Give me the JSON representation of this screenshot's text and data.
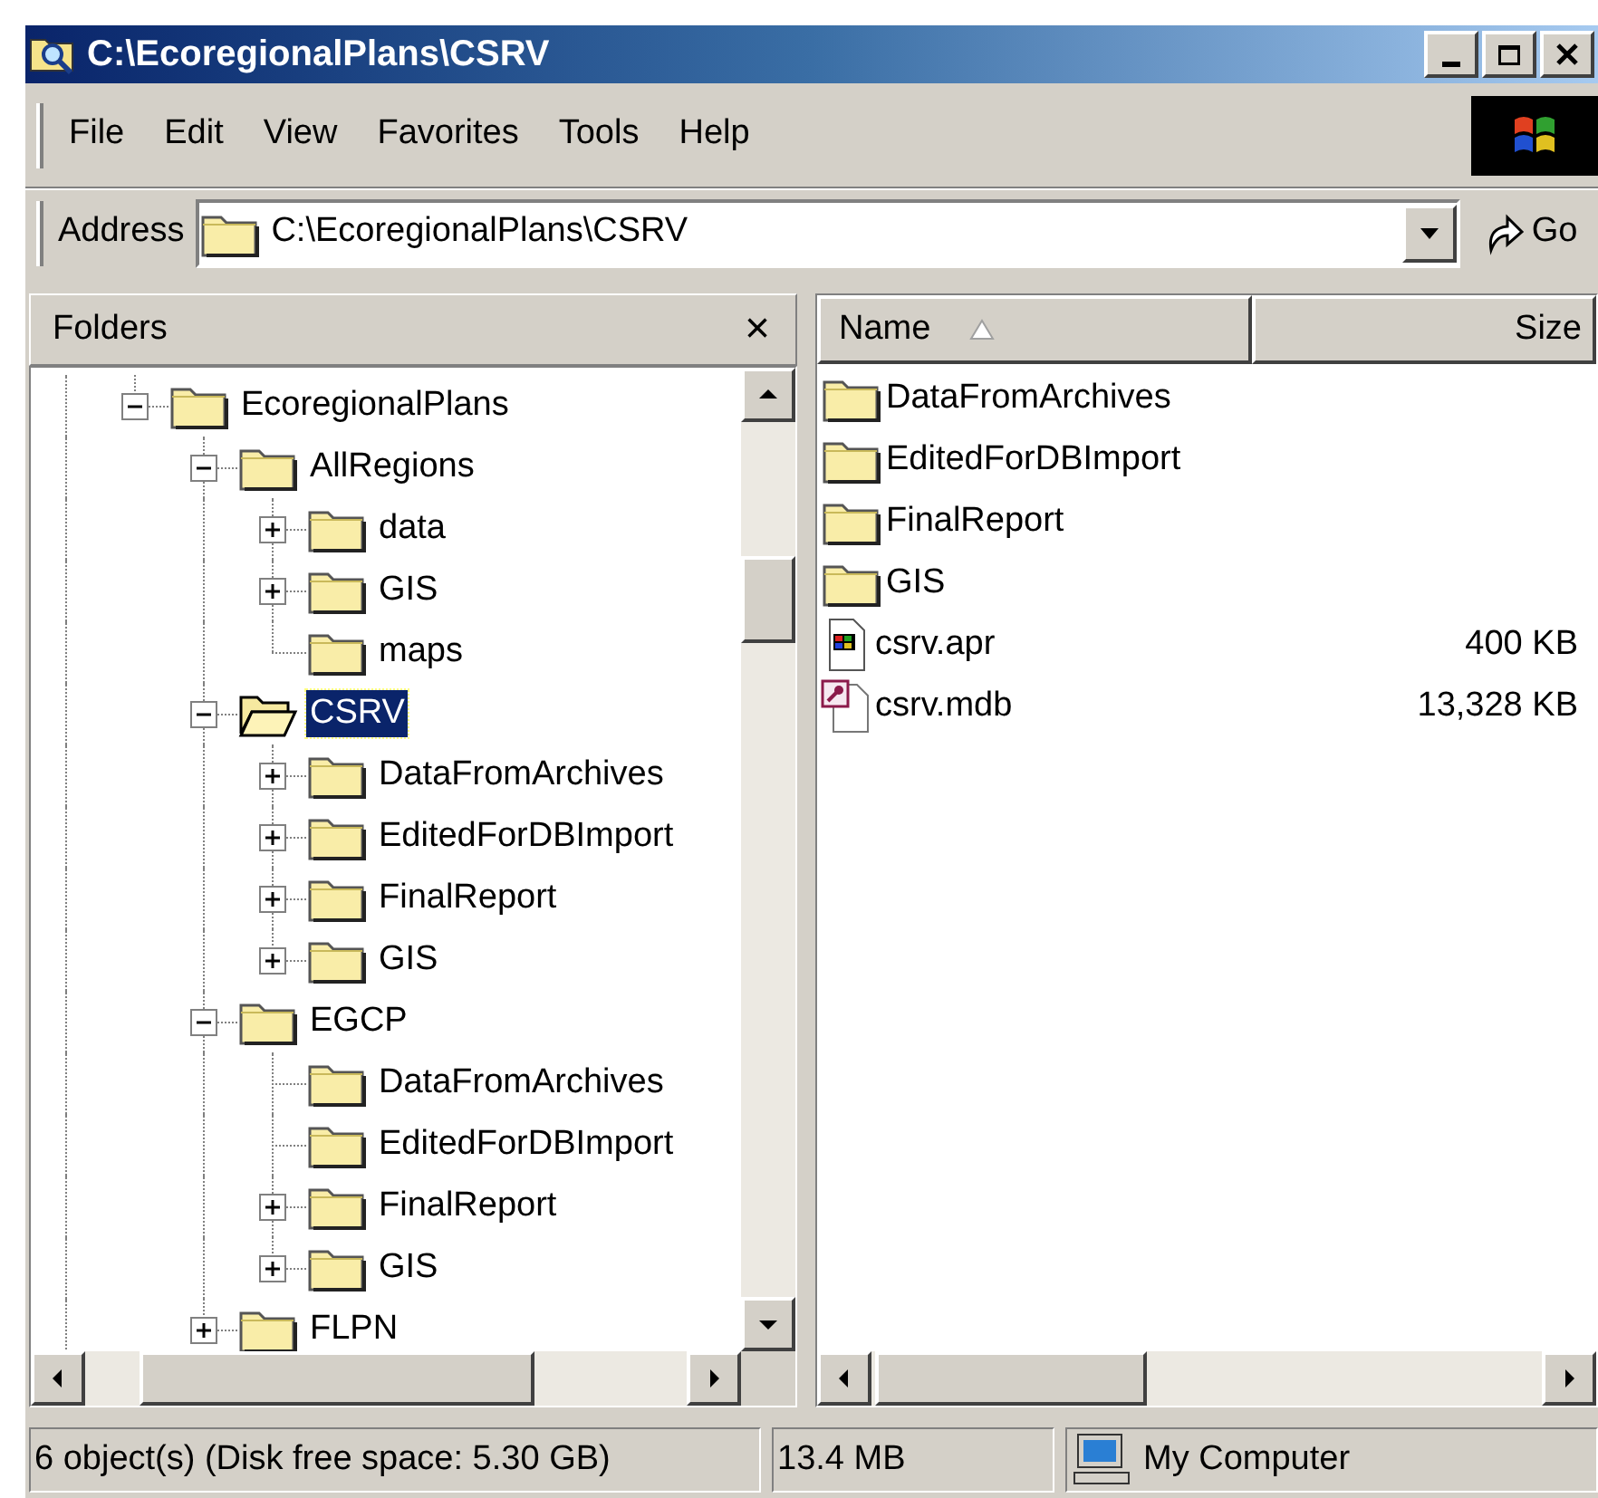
{
  "window": {
    "title": "C:\\EcoregionalPlans\\CSRV"
  },
  "menu": [
    "File",
    "Edit",
    "View",
    "Favorites",
    "Tools",
    "Help"
  ],
  "address": {
    "label": "Address",
    "value": "C:\\EcoregionalPlans\\CSRV",
    "go": "Go"
  },
  "folders": {
    "title": "Folders",
    "close": "×",
    "tree": [
      {
        "label": "EcoregionalPlans",
        "expandable": true,
        "expanded": true,
        "selected": false,
        "children": [
          {
            "label": "AllRegions",
            "expandable": true,
            "expanded": true,
            "selected": false,
            "children": [
              {
                "label": "data",
                "expandable": true,
                "expanded": false,
                "selected": false
              },
              {
                "label": "GIS",
                "expandable": true,
                "expanded": false,
                "selected": false
              },
              {
                "label": "maps",
                "expandable": false,
                "selected": false
              }
            ]
          },
          {
            "label": "CSRV",
            "expandable": true,
            "expanded": true,
            "selected": true,
            "children": [
              {
                "label": "DataFromArchives",
                "expandable": true,
                "expanded": false,
                "selected": false
              },
              {
                "label": "EditedForDBImport",
                "expandable": true,
                "expanded": false,
                "selected": false
              },
              {
                "label": "FinalReport",
                "expandable": true,
                "expanded": false,
                "selected": false
              },
              {
                "label": "GIS",
                "expandable": true,
                "expanded": false,
                "selected": false
              }
            ]
          },
          {
            "label": "EGCP",
            "expandable": true,
            "expanded": true,
            "selected": false,
            "children": [
              {
                "label": "DataFromArchives",
                "expandable": false,
                "selected": false
              },
              {
                "label": "EditedForDBImport",
                "expandable": false,
                "selected": false
              },
              {
                "label": "FinalReport",
                "expandable": true,
                "expanded": false,
                "selected": false
              },
              {
                "label": "GIS",
                "expandable": true,
                "expanded": false,
                "selected": false
              }
            ]
          },
          {
            "label": "FLPN",
            "expandable": true,
            "expanded": false,
            "selected": false
          }
        ]
      }
    ]
  },
  "files": {
    "columns": [
      "Name",
      "Size"
    ],
    "rows": [
      {
        "kind": "folder",
        "name": "DataFromArchives"
      },
      {
        "kind": "folder",
        "name": "EditedForDBImport"
      },
      {
        "kind": "folder",
        "name": "FinalReport"
      },
      {
        "kind": "folder",
        "name": "GIS"
      },
      {
        "kind": "project",
        "name": "csrv.apr",
        "size": "400 KB"
      },
      {
        "kind": "database",
        "name": "csrv.mdb",
        "size": "13,328 KB"
      }
    ]
  },
  "status_bar": {
    "objects": "6 object(s) (Disk free space: 5.30 GB)",
    "size": "13.4 MB",
    "location": "My Computer"
  }
}
